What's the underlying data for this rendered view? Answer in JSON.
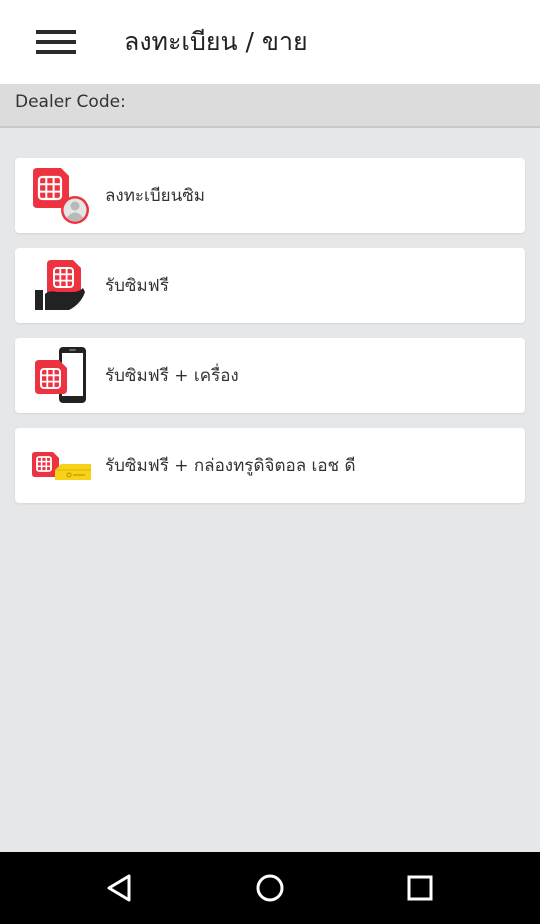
{
  "appbar": {
    "title": "ลงทะเบียน / ขาย",
    "menu_icon": "hamburger-menu-icon"
  },
  "dealer": {
    "label": "Dealer Code:"
  },
  "menu": {
    "items": [
      {
        "label": "ลงทะเบียนซิม",
        "icon": "sim-user-icon"
      },
      {
        "label": "รับซิมฟรี",
        "icon": "sim-hand-icon"
      },
      {
        "label": "รับซิมฟรี + เครื่อง",
        "icon": "sim-phone-icon"
      },
      {
        "label": "รับซิมฟรี + กล่องทรูดิจิตอล เอช ดี",
        "icon": "sim-box-icon"
      }
    ]
  },
  "colors": {
    "accent": "#ee3340",
    "background": "#e6e7e9",
    "card": "#ffffff",
    "dealer_bar": "#dcdcdc",
    "box_yellow": "#f7d218"
  },
  "navbar": {
    "back_icon": "back-triangle-icon",
    "home_icon": "home-circle-icon",
    "recents_icon": "recents-square-icon"
  }
}
